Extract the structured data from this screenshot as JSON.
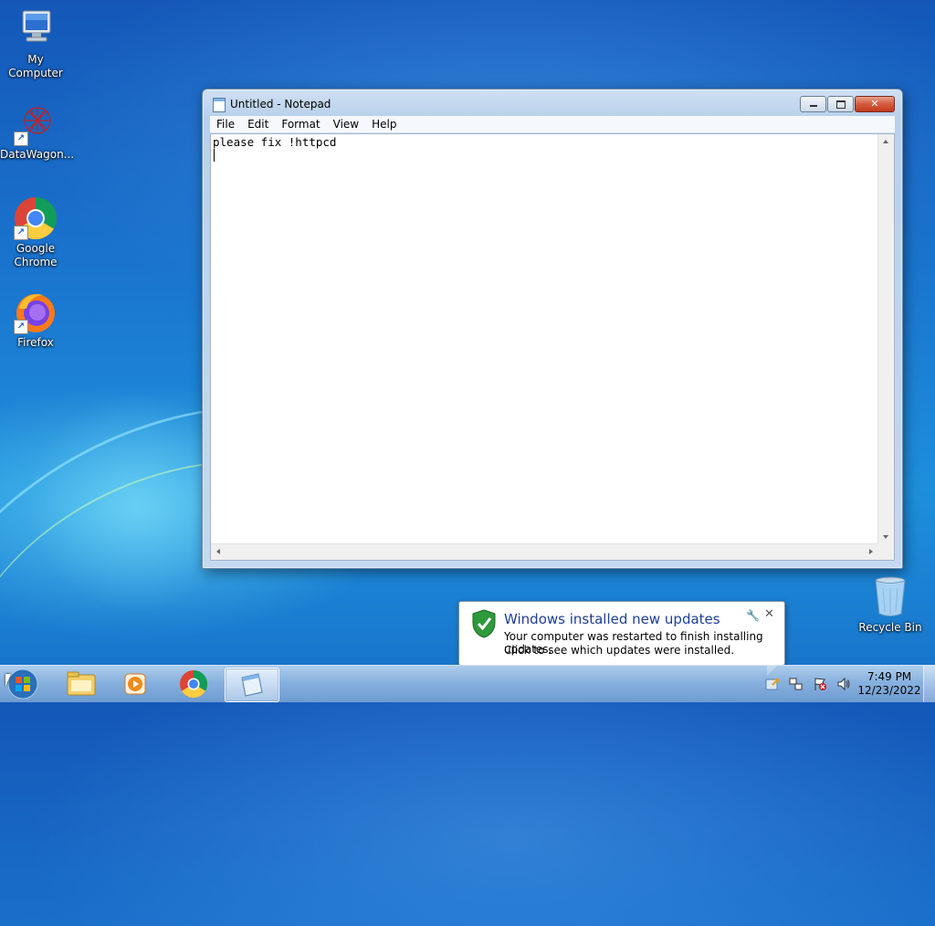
{
  "desktop": {
    "icons": [
      {
        "label": "My Computer",
        "icon": "computer-icon"
      },
      {
        "label": "DataWagon...",
        "icon": "datawagon-icon"
      },
      {
        "label": "Google Chrome",
        "icon": "chrome-icon"
      },
      {
        "label": "Firefox",
        "icon": "firefox-icon"
      },
      {
        "label": "Recycle Bin",
        "icon": "recycle-bin-icon"
      }
    ]
  },
  "notepad": {
    "title": "Untitled - Notepad",
    "menu": [
      "File",
      "Edit",
      "Format",
      "View",
      "Help"
    ],
    "content": "please fix !httpcd",
    "controls": {
      "minimize": "minimize",
      "maximize": "maximize",
      "close": "close"
    }
  },
  "notification": {
    "title": "Windows installed new updates",
    "line1": "Your computer was restarted to finish installing updates.",
    "line2": "Click to see which updates were installed."
  },
  "taskbar": {
    "pinned": [
      {
        "name": "windows-explorer",
        "icon": "folder-icon"
      },
      {
        "name": "windows-media-player",
        "icon": "media-player-icon"
      },
      {
        "name": "google-chrome",
        "icon": "chrome-icon"
      },
      {
        "name": "notepad",
        "icon": "notepad-icon",
        "active": true
      }
    ],
    "clock": {
      "time": "7:49 PM",
      "date": "12/23/2022"
    }
  },
  "colors": {
    "desktop_bg": "#1a76cf",
    "balloon_title": "#1d3e99",
    "close_button": "#c13b1e"
  }
}
